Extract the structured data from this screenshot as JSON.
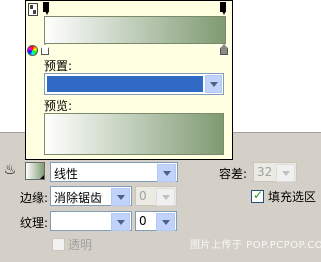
{
  "popup": {
    "preset_label": "预置:",
    "preset_value": "",
    "preview_label": "预览:",
    "gradient_colors": [
      "#ffffff",
      "#7f9b72"
    ],
    "preset_highlight": "#316ac5"
  },
  "fill": {
    "type_value": "线性",
    "tolerance_label": "容差:",
    "tolerance_value": "32",
    "edge_label": "边缘:",
    "edge_value": "消除锯齿",
    "feather_value": "0",
    "fill_selection_label": "填充选区",
    "fill_selection_checked": true,
    "texture_label": "纹理:",
    "texture_value": "",
    "texture_amount": "0",
    "transparent_label": "透明",
    "transparent_checked": false
  },
  "watermark": "图片上传于 POP.PCPOP.COM",
  "icons": {
    "paint_bucket": "paint-bucket-icon",
    "color_wheel": "color-wheel-icon"
  }
}
